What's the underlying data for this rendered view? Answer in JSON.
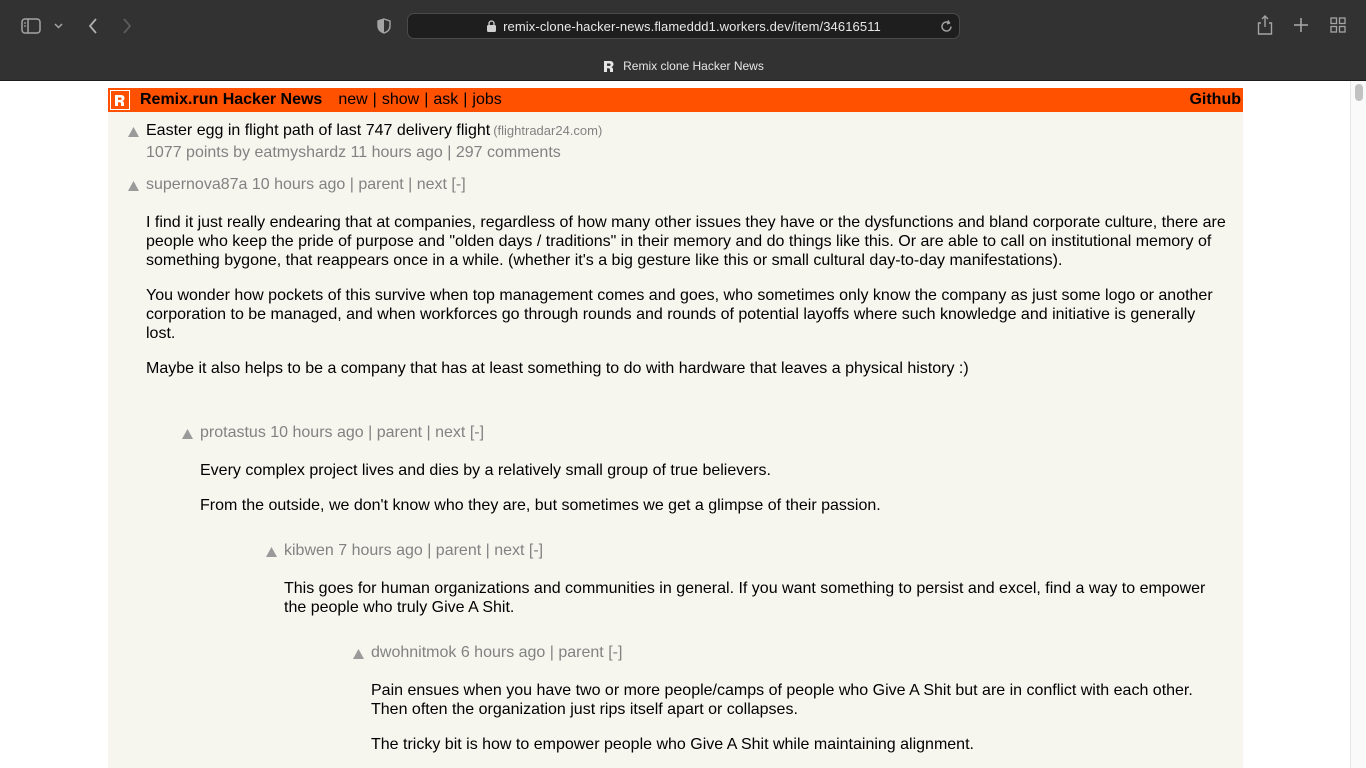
{
  "browser": {
    "url": "remix-clone-hacker-news.flameddd1.workers.dev/item/34616511",
    "tab_title": "Remix clone Hacker News"
  },
  "site": {
    "brand": "Remix.run Hacker News",
    "nav": [
      "new",
      "show",
      "ask",
      "jobs"
    ],
    "github": "Github",
    "colors": {
      "header": "#ff5100",
      "background": "#f6f6ef",
      "meta": "#828282"
    }
  },
  "story": {
    "title": "Easter egg in flight path of last 747 delivery flight",
    "site": "(flightradar24.com)",
    "subtext": "1077 points by eatmyshardz 11 hours ago | 297 comments"
  },
  "comments": [
    {
      "meta": "supernova87a 10 hours ago | parent | next [-]",
      "paragraphs": [
        "I find it just really endearing that at companies, regardless of how many other issues they have or the dysfunctions and bland corporate culture, there are people who keep the pride of purpose and \"olden days / traditions\" in their memory and do things like this. Or are able to call on institutional memory of something bygone, that reappears once in a while. (whether it's a big gesture like this or small cultural day-to-day manifestations).",
        "You wonder how pockets of this survive when top management comes and goes, who sometimes only know the company as just some logo or another corporation to be managed, and when workforces go through rounds and rounds of potential layoffs where such knowledge and initiative is generally lost.",
        "Maybe it also helps to be a company that has at least something to do with hardware that leaves a physical history :)"
      ]
    },
    {
      "meta": "protastus 10 hours ago | parent | next [-]",
      "paragraphs": [
        "Every complex project lives and dies by a relatively small group of true believers.",
        "From the outside, we don't know who they are, but sometimes we get a glimpse of their passion."
      ]
    },
    {
      "meta": "kibwen 7 hours ago | parent | next [-]",
      "paragraphs": [
        "This goes for human organizations and communities in general. If you want something to persist and excel, find a way to empower the people who truly Give A Shit."
      ]
    },
    {
      "meta": "dwohnitmok 6 hours ago | parent [-]",
      "paragraphs": [
        "Pain ensues when you have two or more people/camps of people who Give A Shit but are in conflict with each other. Then often the organization just rips itself apart or collapses.",
        "The tricky bit is how to empower people who Give A Shit while maintaining alignment."
      ]
    }
  ]
}
